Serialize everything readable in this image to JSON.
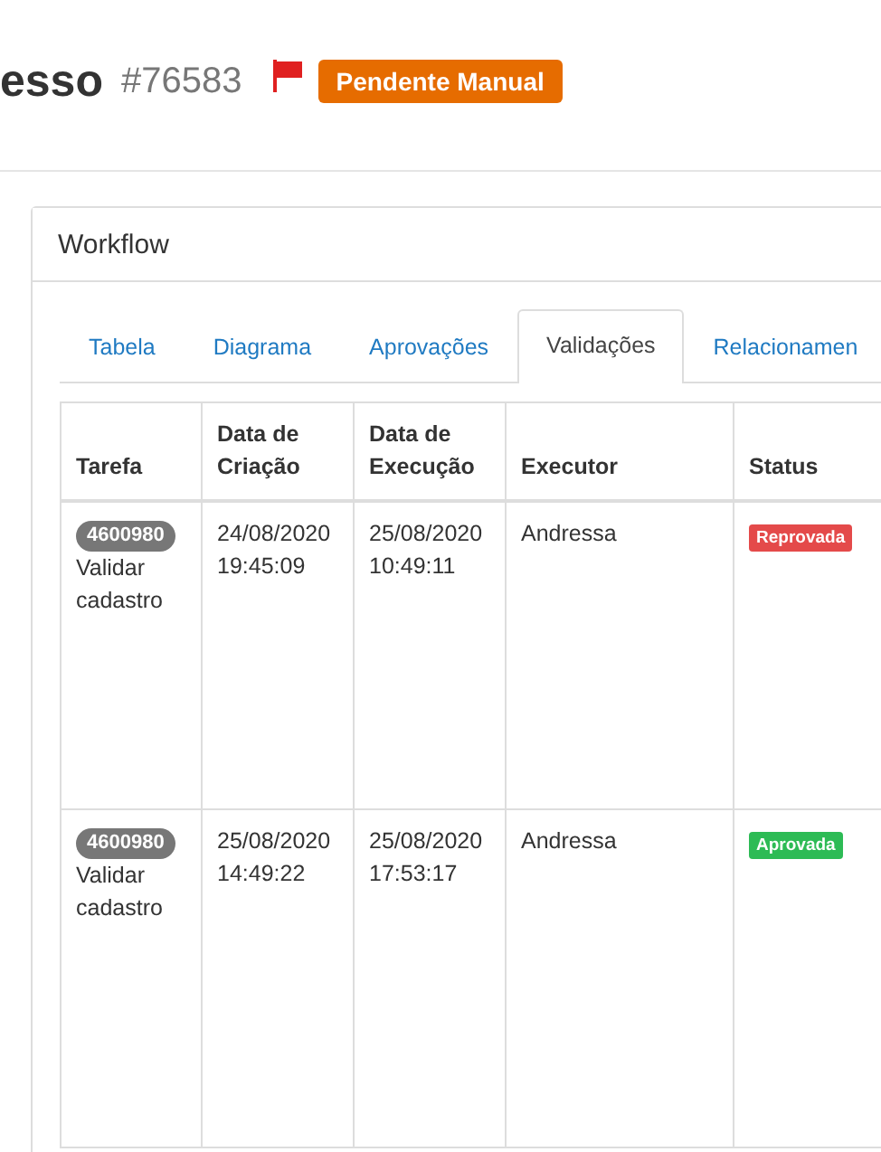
{
  "header": {
    "title": "esso",
    "number": "#76583",
    "flagged": true,
    "badge": "Pendente Manual"
  },
  "panel": {
    "title": "Workflow",
    "tabs": [
      {
        "label": "Tabela",
        "selected": false
      },
      {
        "label": "Diagrama",
        "selected": false
      },
      {
        "label": "Aprovações",
        "selected": false
      },
      {
        "label": "Validações",
        "selected": true
      },
      {
        "label": "Relacionamen",
        "selected": false
      }
    ],
    "table": {
      "columns": [
        "Tarefa",
        "Data de Criação",
        "Data de Execução",
        "Executor",
        "Status"
      ],
      "rows": [
        {
          "task_id": "4600980",
          "task": "Validar cadastro",
          "created": "24/08/2020 19:45:09",
          "executed": "25/08/2020 10:49:11",
          "executor": "Andressa",
          "status": {
            "label": "Reprovada",
            "kind": "rejected"
          }
        },
        {
          "task_id": "4600980",
          "task": "Validar cadastro",
          "created": "25/08/2020 14:49:22",
          "executed": "25/08/2020 17:53:17",
          "executor": "Andressa",
          "status": {
            "label": "Aprovada",
            "kind": "approved"
          }
        }
      ]
    }
  }
}
